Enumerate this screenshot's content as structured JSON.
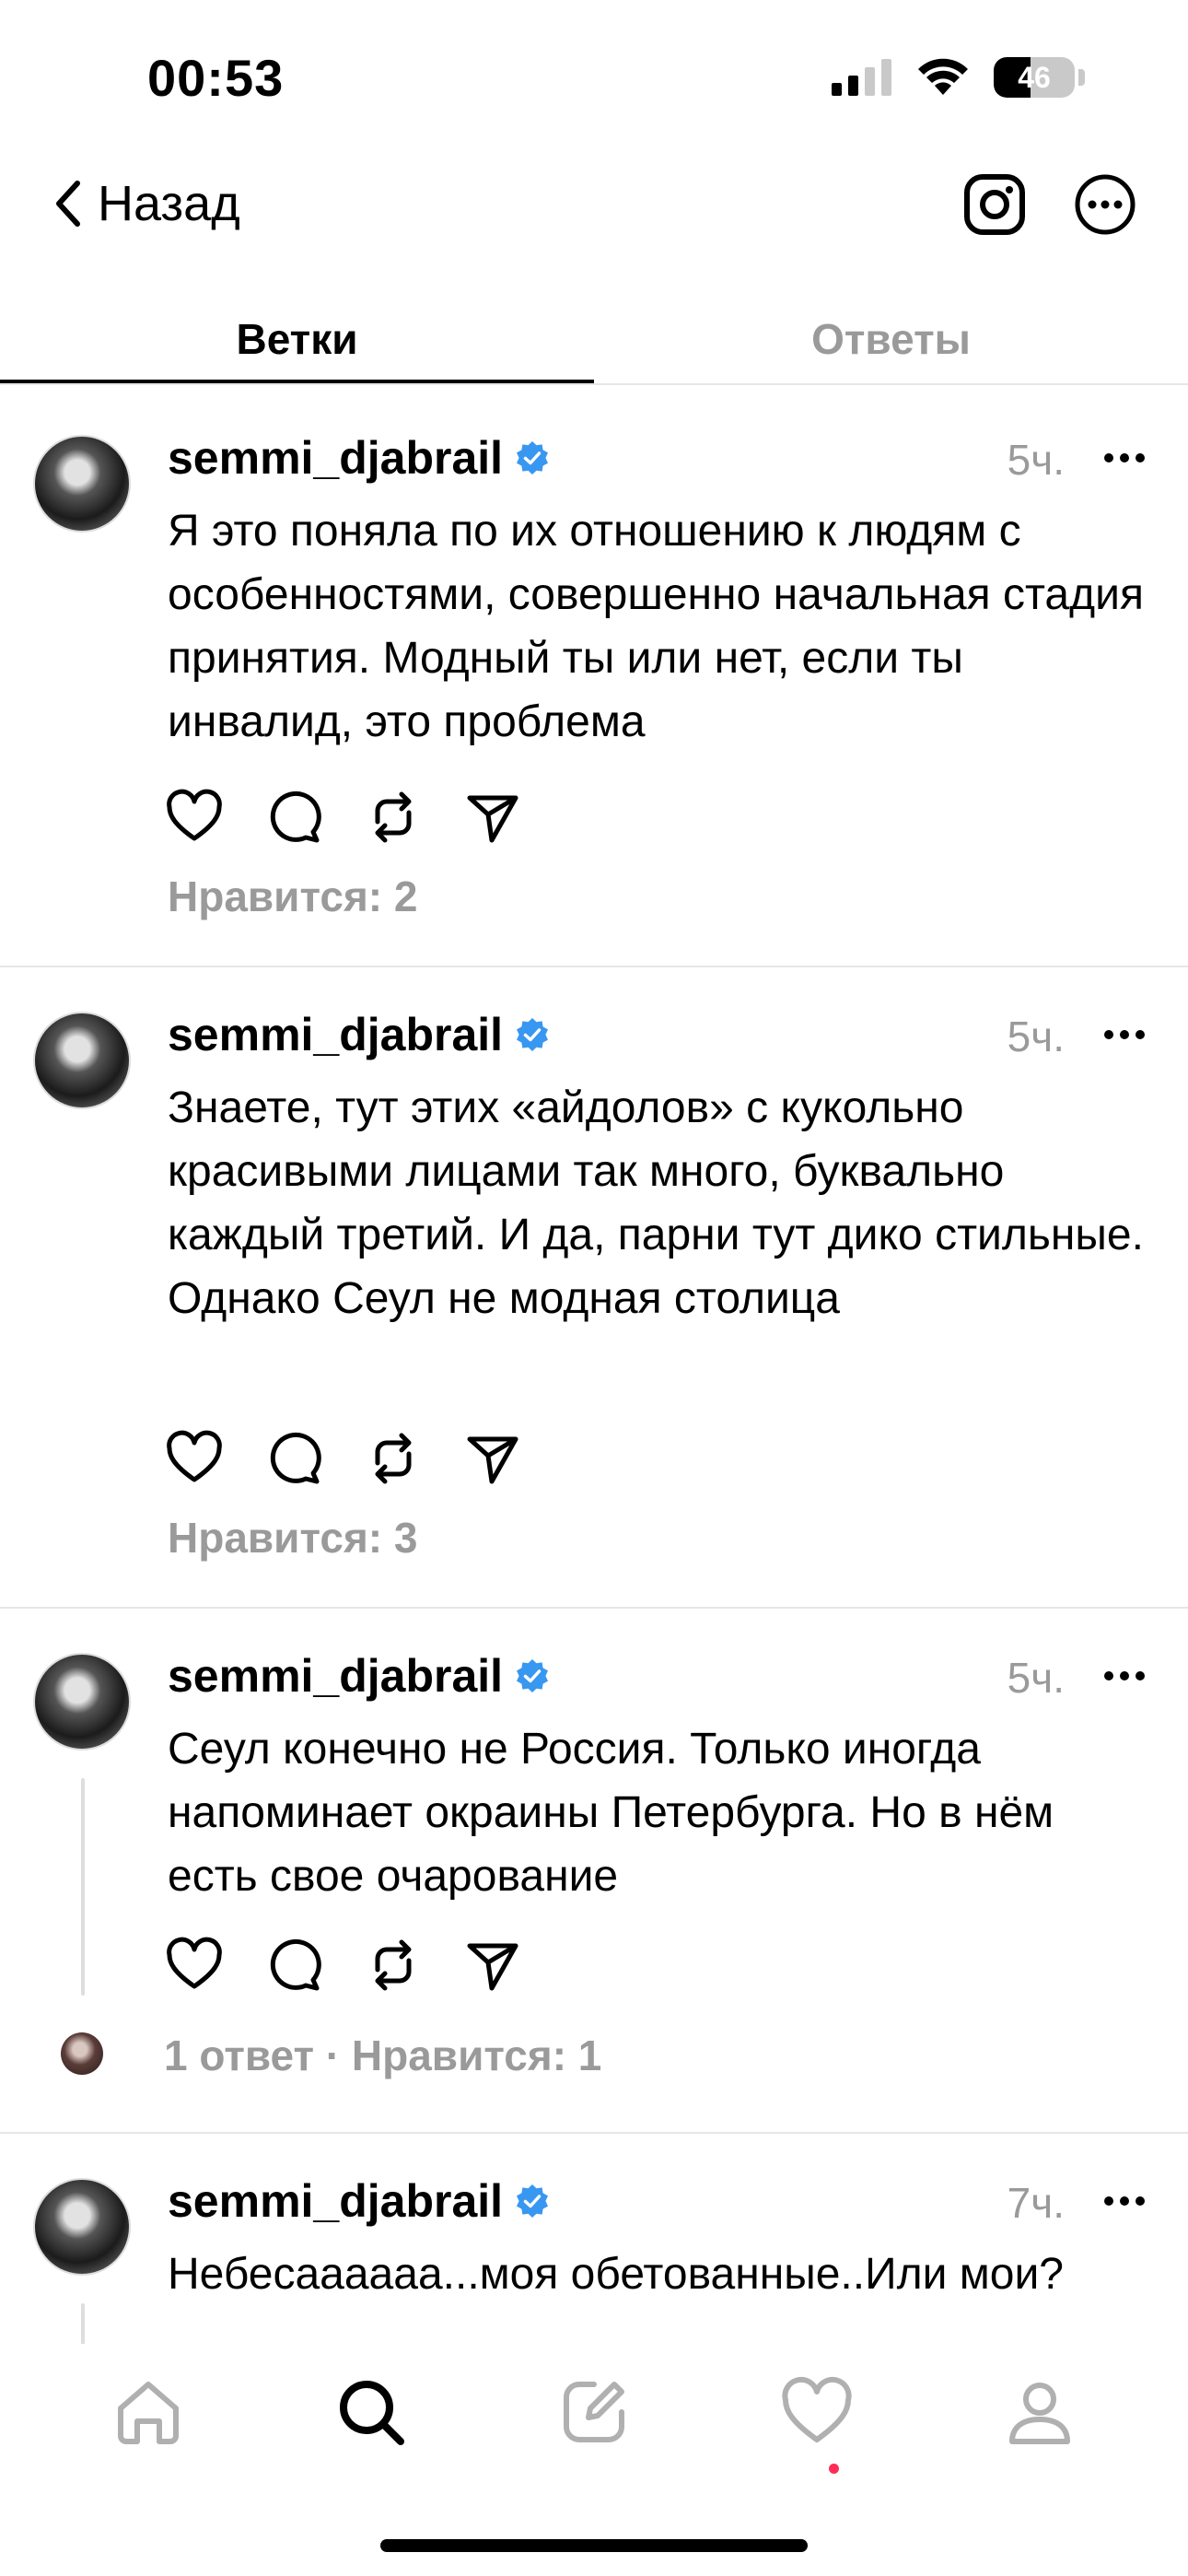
{
  "status_bar": {
    "time": "00:53",
    "battery": "46",
    "battery_level": 0.46
  },
  "nav": {
    "back_label": "Назад",
    "instagram_icon": "instagram-icon",
    "more_icon": "more-circle-icon"
  },
  "tabs": [
    {
      "label": "Ветки",
      "active": true
    },
    {
      "label": "Ответы",
      "active": false
    }
  ],
  "posts": [
    {
      "username": "semmi_djabrail",
      "verified": true,
      "time": "5ч.",
      "text": "Я это поняла по их отношению к людям с особенностями, совершенно начальная стадия принятия. Модный ты или нет, если ты инвалид, это проблема",
      "stats": "Нравится: 2"
    },
    {
      "username": "semmi_djabrail",
      "verified": true,
      "time": "5ч.",
      "text": "Знаете, тут этих «айдолов» с кукольно красивыми лицами так много, буквально каждый третий. И да, парни тут дико стильные. Однако Сеул не модная столица",
      "stats": "Нравится: 3"
    },
    {
      "username": "semmi_djabrail",
      "verified": true,
      "time": "5ч.",
      "text": "Сеул конечно не Россия. Только иногда напоминает окраины Петербурга. Но в нём есть свое очарование",
      "stats": "1 ответ · Нравится: 1"
    },
    {
      "username": "semmi_djabrail",
      "verified": true,
      "time": "7ч.",
      "text": "Небесаааааа...моя обетованные..Или мои?",
      "stats": ""
    }
  ],
  "bottom_nav": [
    "home-icon",
    "search-icon",
    "compose-icon",
    "activity-heart-icon",
    "profile-icon"
  ],
  "colors": {
    "verified_blue": "#3897f0",
    "muted_gray": "#9a9a9a",
    "notification_red": "#ff2d55"
  }
}
